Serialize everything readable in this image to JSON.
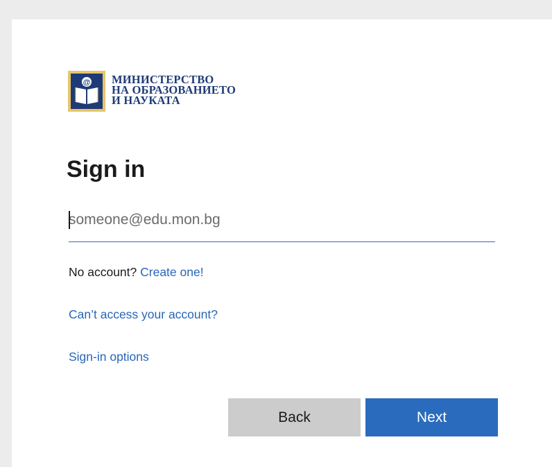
{
  "logo": {
    "icon": "ministry-book-at-icon",
    "line1": "МИНИСТЕРСТВО",
    "line2": "НА ОБРАЗОВАНИЕТО",
    "line3": "И НАУКАТА",
    "colors": {
      "navy": "#1f3b76",
      "gold": "#e8c56b"
    }
  },
  "title": "Sign in",
  "email": {
    "value": "",
    "placeholder": "someone@edu.mon.bg"
  },
  "no_account": {
    "text": "No account?",
    "link": "Create one!"
  },
  "links": {
    "cant_access": "Can’t access your account?",
    "signin_options": "Sign-in options"
  },
  "buttons": {
    "back": "Back",
    "next": "Next"
  },
  "colors": {
    "accent": "#2a6bbd",
    "link": "#2766b8",
    "back_button": "#cccccc"
  }
}
